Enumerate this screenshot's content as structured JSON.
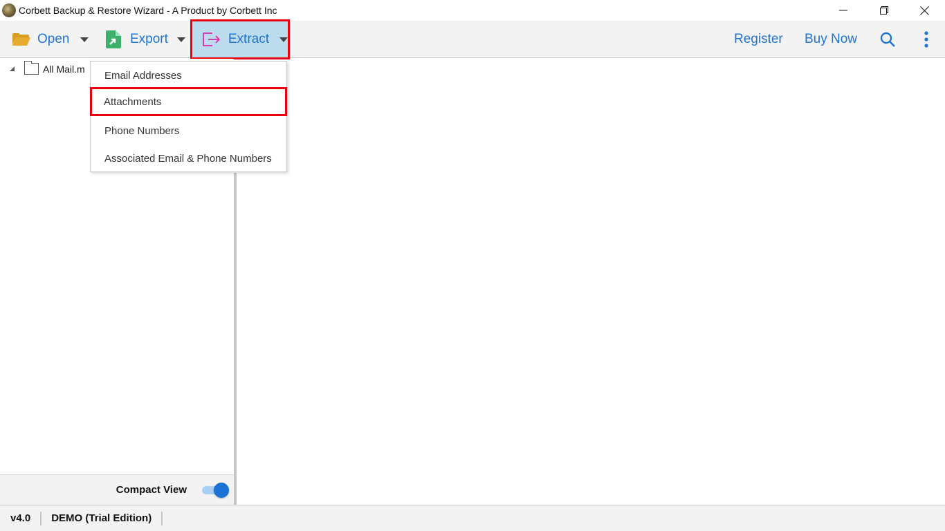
{
  "window": {
    "title": "Corbett Backup & Restore Wizard - A Product by Corbett Inc",
    "controls": {
      "minimize": "minimize-icon",
      "restore": "restore-icon",
      "close": "close-icon"
    }
  },
  "toolbar": {
    "open_label": "Open",
    "export_label": "Export",
    "extract_label": "Extract",
    "register_label": "Register",
    "buy_now_label": "Buy Now",
    "icons": {
      "open": "folder-open-icon",
      "export": "file-export-icon",
      "extract": "extract-arrow-icon",
      "search": "search-icon",
      "more": "more-vertical-icon"
    },
    "colors": {
      "link": "#1f74d1",
      "active_bg": "#bcdcee",
      "highlight_border": "#e8000c",
      "open_icon": "#e0a82a",
      "export_icon": "#3db06b",
      "extract_icon": "#d63bb0"
    }
  },
  "extract_menu": {
    "items": [
      {
        "label": "Email Addresses",
        "highlighted": false
      },
      {
        "label": "Attachments",
        "highlighted": true
      },
      {
        "label": "Phone Numbers",
        "highlighted": false
      },
      {
        "label": "Associated Email & Phone Numbers",
        "highlighted": false
      }
    ]
  },
  "tree": {
    "root_label": "All Mail.m",
    "expanded": true
  },
  "left_pane": {
    "compact_view_label": "Compact View",
    "compact_view_on": true
  },
  "status": {
    "version": "v4.0",
    "edition": "DEMO (Trial Edition)"
  }
}
